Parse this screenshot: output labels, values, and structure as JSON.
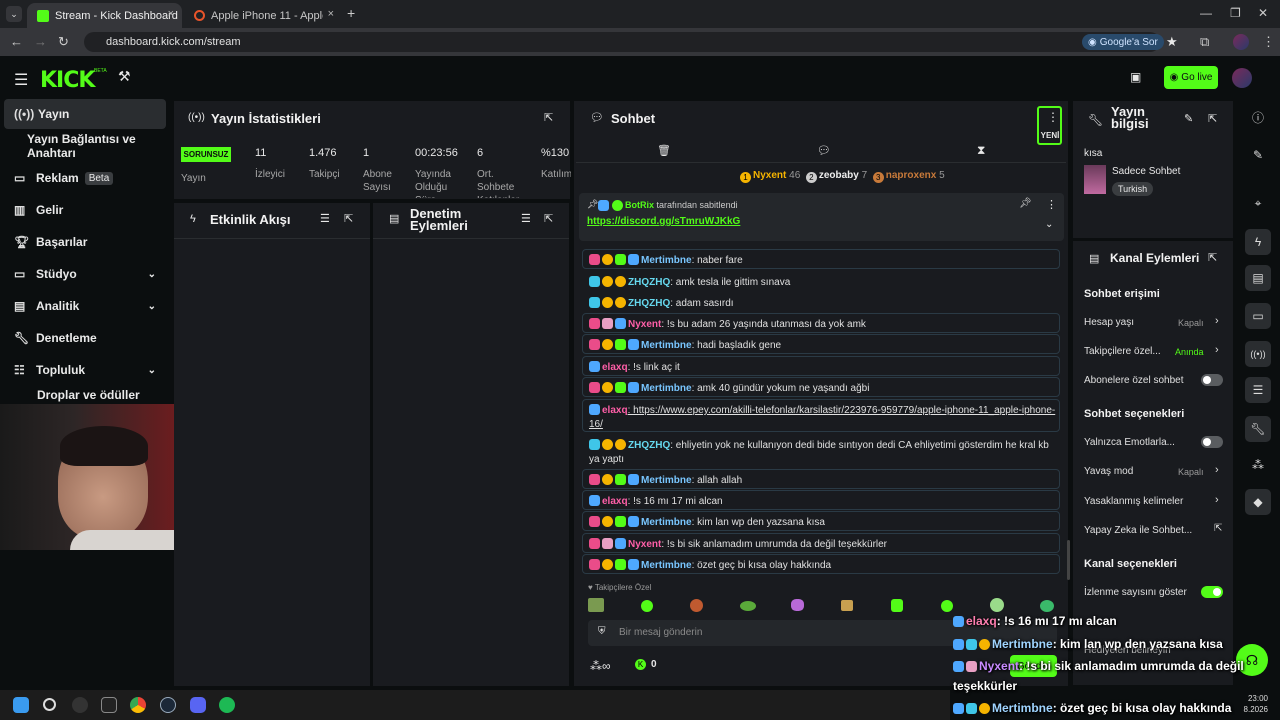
{
  "browser": {
    "tabs": [
      {
        "title": "Stream - Kick Dashboard",
        "close": "×"
      },
      {
        "title": "Apple iPhone 11 - Apple iPhone",
        "close": "×"
      }
    ],
    "new_tab": "+",
    "url": "dashboard.kick.com/stream",
    "google_button": "Google'a Sor"
  },
  "header": {
    "logo": "KICK",
    "beta": "BETA",
    "go_live": "Go live"
  },
  "sidebar": {
    "items": [
      {
        "label": "Yayın",
        "icon": "broadcast-icon"
      },
      {
        "label": "Yayın Bağlantısı ve Anahtarı"
      },
      {
        "label": "Reklam",
        "badge": "Beta",
        "icon": "ad-icon"
      },
      {
        "label": "Gelir",
        "icon": "chart-icon"
      },
      {
        "label": "Başarılar",
        "icon": "trophy-icon"
      },
      {
        "label": "Stüdyo",
        "icon": "studio-icon"
      },
      {
        "label": "Analitik",
        "icon": "analytics-icon"
      },
      {
        "label": "Denetleme",
        "icon": "wrench-icon"
      },
      {
        "label": "Topluluk",
        "icon": "community-icon"
      },
      {
        "label": "Droplar ve ödüller"
      }
    ]
  },
  "stats": {
    "title": "Yayın İstatistikleri",
    "status": "SORUNSUZ",
    "status_label": "Yayın",
    "cells": [
      {
        "value": "11",
        "label": "İzleyici"
      },
      {
        "value": "1.476",
        "label": "Takipçi"
      },
      {
        "value": "1",
        "label": "Abone Sayısı"
      },
      {
        "value": "00:23:56",
        "label": "Yayında Olduğu Süre"
      },
      {
        "value": "6",
        "label": "Ort. Sohbete Katılanlar"
      },
      {
        "value": "%130",
        "label": "Katılım"
      }
    ]
  },
  "activity": {
    "title": "Etkinlik Akışı"
  },
  "moderation": {
    "title": "Denetim Eylemleri"
  },
  "chat": {
    "title": "Sohbet",
    "new_label": "YENİ",
    "top_gifters": [
      {
        "rank": "1",
        "name": "Nyxent",
        "count": "46"
      },
      {
        "rank": "2",
        "name": "zeobaby",
        "count": "7"
      },
      {
        "rank": "3",
        "name": "naproxenx",
        "count": "5"
      }
    ],
    "pinned": {
      "by": "BotRix",
      "by_suffix": "tarafından sabitlendi",
      "link": "https://discord.gg/sTmruWJKkG"
    },
    "messages": [
      {
        "user": "Mertimbne",
        "text": ": naber fare",
        "color": "#79c6ff"
      },
      {
        "user": "ZHQZHQ",
        "text": ": amk tesla ile gittim sınava",
        "color": "#66d9ef"
      },
      {
        "user": "ZHQZHQ",
        "text": ": adam sasırdı",
        "color": "#66d9ef"
      },
      {
        "user": "Nyxent",
        "text": ": !s bu adam 26 yaşında utanması da yok amk",
        "color": "#ff5fa8"
      },
      {
        "user": "Mertimbne",
        "text": ": hadi başladık gene",
        "color": "#79c6ff"
      },
      {
        "user": "elaxq",
        "text": ": !s link aç it",
        "color": "#ff5fa8"
      },
      {
        "user": "Mertimbne",
        "text": ": amk 40 gündür yokum ne yaşandı ağbi",
        "color": "#79c6ff"
      },
      {
        "user": "elaxq",
        "text": ": https://www.epey.com/akilli-telefonlar/karsilastir/223976-959779/apple-iphone-11_apple-iphone-16/",
        "color": "#ff5fa8"
      },
      {
        "user": "ZHQZHQ",
        "text": ": ehliyetin yok ne kullanıyon dedi bide sıntıyon dedi CA ehliyetimi gösterdim he kral kb ya yaptı",
        "color": "#66d9ef"
      },
      {
        "user": "Mertimbne",
        "text": ": allah allah",
        "color": "#79c6ff"
      },
      {
        "user": "elaxq",
        "text": ": !s 16 mı 17 mi alcan",
        "color": "#ff5fa8"
      },
      {
        "user": "Mertimbne",
        "text": ": kim lan wp den yazsana kısa",
        "color": "#79c6ff"
      },
      {
        "user": "Nyxent",
        "text": ": !s bi sik anlamadım umrumda da değil teşekkürler",
        "color": "#ff5fa8"
      },
      {
        "user": "Mertimbne",
        "text": ": özet geç bi kısa olay hakkında",
        "color": "#79c6ff"
      }
    ],
    "followers_only": "Takipçilere Özel",
    "input_placeholder": "Bir mesaj gönderin",
    "points": "0",
    "send": "Gönder"
  },
  "stream_info": {
    "title": "Yayın bilgisi",
    "stream_title": "kısa",
    "category": "Sadece Sohbet",
    "tag": "Turkish"
  },
  "channel_actions": {
    "title": "Kanal Eylemleri",
    "chat_access": "Sohbet erişimi",
    "account_age": {
      "label": "Hesap yaşı",
      "value": "Kapalı"
    },
    "followers": {
      "label": "Takipçilere özel...",
      "value": "Anında"
    },
    "subscribers": {
      "label": "Abonelere özel sohbet"
    },
    "chat_options": "Sohbet seçenekleri",
    "emotes": {
      "label": "Yalnızca Emotlarla..."
    },
    "slow": {
      "label": "Yavaş mod",
      "value": "Kapalı"
    },
    "banned_words": {
      "label": "Yasaklanmış kelimeler"
    },
    "ai": {
      "label": "Yapay Zeka ile Sohbet..."
    },
    "channel_options": "Kanal seçenekleri",
    "show_viewers": {
      "label": "İzlenme sayısını göster"
    },
    "gift": {
      "label": "Hediyeleri belirleyin"
    }
  },
  "overlay": [
    {
      "user": "elaxq",
      "text": ": !s 16 mı 17 mı alcan"
    },
    {
      "user": "Mertimbne",
      "text": ": kim lan wp den yazsana kısa"
    },
    {
      "user": "Nyxent",
      "text": ": !s bi sik anlamadım umrumda da değil"
    },
    {
      "user": "",
      "text": "teşekkürler"
    },
    {
      "user": "Mertimbne",
      "text": ": özet geç bi kısa olay hakkında"
    }
  ],
  "clock": {
    "time": "23:00",
    "date": "8.2026"
  }
}
